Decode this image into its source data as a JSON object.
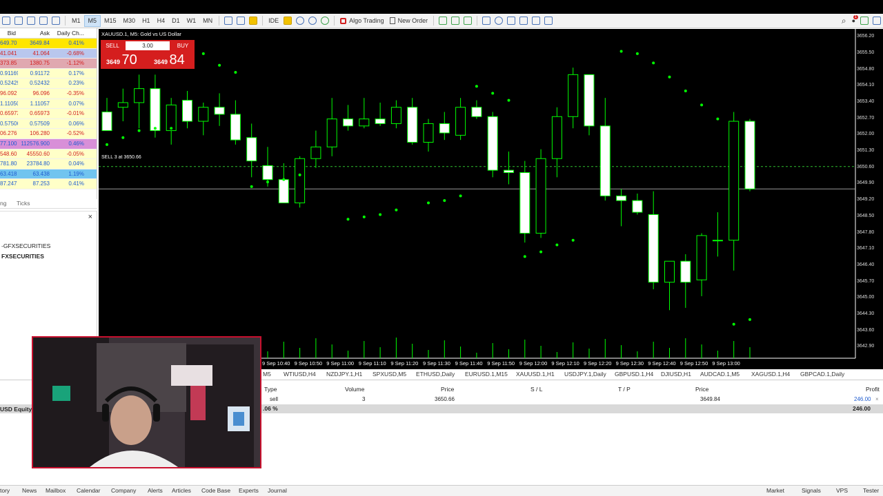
{
  "toolbar": {
    "timeframes": [
      "M1",
      "M5",
      "M15",
      "M30",
      "H1",
      "H4",
      "D1",
      "W1",
      "MN"
    ],
    "active_timeframe": "M5",
    "ide_label": "IDE",
    "algo_trading_label": "Algo Trading",
    "new_order_label": "New Order",
    "notification_count": "1"
  },
  "market_watch": {
    "headers": {
      "bid": "Bid",
      "ask": "Ask",
      "daily": "Daily Ch..."
    },
    "rows": [
      {
        "bid": "649.70",
        "ask": "3649.84",
        "change": "0.41%",
        "bg": "#ffe600"
      },
      {
        "bid": "41.041",
        "ask": "41.064",
        "change": "-0.68%",
        "bg": "#b9c7ee"
      },
      {
        "bid": "373.85",
        "ask": "1380.75",
        "change": "-1.12%",
        "bg": "#e0a8b0"
      },
      {
        "bid": "0.91169",
        "ask": "0.91172",
        "change": "0.17%",
        "bg": "#ffffc8"
      },
      {
        "bid": "0.52429",
        "ask": "0.52432",
        "change": "0.23%",
        "bg": "#ffffc8"
      },
      {
        "bid": "96.092",
        "ask": "96.096",
        "change": "-0.35%",
        "bg": "#ffffc8"
      },
      {
        "bid": "1.11050",
        "ask": "1.11057",
        "change": "0.07%",
        "bg": "#ffffc8"
      },
      {
        "bid": "0.65973",
        "ask": "0.65973",
        "change": "-0.01%",
        "bg": "#ffffc8"
      },
      {
        "bid": "0.57506",
        "ask": "0.57509",
        "change": "0.06%",
        "bg": "#ffffc8"
      },
      {
        "bid": "06.276",
        "ask": "106.280",
        "change": "-0.52%",
        "bg": "#ffffc8"
      },
      {
        "bid": "77.100",
        "ask": "112576.900",
        "change": "0.46%",
        "bg": "#d88fd8"
      },
      {
        "bid": "548.60",
        "ask": "45550.60",
        "change": "-0.05%",
        "bg": "#ffffc8"
      },
      {
        "bid": "781.80",
        "ask": "23784.80",
        "change": "0.04%",
        "bg": "#ffffc8"
      },
      {
        "bid": "63.418",
        "ask": "63.438",
        "change": "1.19%",
        "bg": "#71c4ef"
      },
      {
        "bid": "87.247",
        "ask": "87.253",
        "change": "0.41%",
        "bg": "#ffffc8"
      }
    ],
    "tabs": [
      "ng",
      "Ticks"
    ]
  },
  "navigator": {
    "close": "×",
    "servers": [
      "-GFXSECURITIES",
      "FXSECURITIES"
    ]
  },
  "chart": {
    "title": "XAUUSD.1, M5:  Gold vs US Dollar",
    "one_click": {
      "sell_label": "SELL",
      "buy_label": "BUY",
      "volume": "3.00",
      "sell_small": "3649",
      "sell_big": "70",
      "buy_small": "3649",
      "buy_big": "84"
    },
    "sell_line_label": "SELL 3 at 3650.66",
    "price_ticks": [
      "3656.20",
      "3655.50",
      "3654.80",
      "3654.10",
      "3653.40",
      "3652.70",
      "3652.00",
      "3651.30",
      "3650.60",
      "3649.90",
      "3649.20",
      "3648.50",
      "3647.80",
      "3647.10",
      "3646.40",
      "3645.70",
      "3645.00",
      "3644.30",
      "3643.60",
      "3642.90"
    ],
    "time_ticks": [
      "9 Sep 10:40",
      "9 Sep 10:50",
      "9 Sep 11:00",
      "9 Sep 11:10",
      "9 Sep 11:20",
      "9 Sep 11:30",
      "9 Sep 11:40",
      "9 Sep 11:50",
      "9 Sep 12:00",
      "9 Sep 12:10",
      "9 Sep 12:20",
      "9 Sep 12:30",
      "9 Sep 12:40",
      "9 Sep 12:50",
      "9 Sep 13:00"
    ],
    "colors": {
      "bull": "#00ff00",
      "bear_body": "#ffffff",
      "sar": "#00ff00",
      "bg": "#000000"
    }
  },
  "chart_data": {
    "type": "candlestick",
    "symbol": "XAUUSD.1",
    "timeframe": "M5",
    "ylim": [
      3642.5,
      3656.5
    ],
    "sell_order_price": 3650.66,
    "bid_line": 3649.7,
    "candles": [
      {
        "o": 3653.0,
        "h": 3653.6,
        "l": 3652.2,
        "c": 3652.2
      },
      {
        "o": 3653.2,
        "h": 3654.0,
        "l": 3652.6,
        "c": 3653.4
      },
      {
        "o": 3653.4,
        "h": 3654.6,
        "l": 3652.3,
        "c": 3654.0
      },
      {
        "o": 3654.0,
        "h": 3654.6,
        "l": 3651.9,
        "c": 3652.2
      },
      {
        "o": 3652.2,
        "h": 3653.6,
        "l": 3651.6,
        "c": 3653.3
      },
      {
        "o": 3653.5,
        "h": 3653.9,
        "l": 3652.3,
        "c": 3652.6
      },
      {
        "o": 3652.6,
        "h": 3653.4,
        "l": 3652.0,
        "c": 3653.2
      },
      {
        "o": 3653.2,
        "h": 3653.8,
        "l": 3652.4,
        "c": 3652.9
      },
      {
        "o": 3652.9,
        "h": 3653.5,
        "l": 3651.6,
        "c": 3651.8
      },
      {
        "o": 3651.9,
        "h": 3652.5,
        "l": 3650.2,
        "c": 3650.9
      },
      {
        "o": 3650.7,
        "h": 3651.5,
        "l": 3649.8,
        "c": 3650.1
      },
      {
        "o": 3650.1,
        "h": 3650.8,
        "l": 3649.1,
        "c": 3649.1
      },
      {
        "o": 3649.1,
        "h": 3651.1,
        "l": 3648.9,
        "c": 3651.0
      },
      {
        "o": 3651.0,
        "h": 3652.2,
        "l": 3650.6,
        "c": 3651.5
      },
      {
        "o": 3651.5,
        "h": 3653.6,
        "l": 3651.1,
        "c": 3652.7
      },
      {
        "o": 3652.7,
        "h": 3653.3,
        "l": 3652.2,
        "c": 3652.4
      },
      {
        "o": 3652.4,
        "h": 3653.6,
        "l": 3652.3,
        "c": 3652.7
      },
      {
        "o": 3652.7,
        "h": 3653.4,
        "l": 3652.4,
        "c": 3652.5
      },
      {
        "o": 3652.5,
        "h": 3653.5,
        "l": 3652.3,
        "c": 3653.2
      },
      {
        "o": 3653.2,
        "h": 3653.6,
        "l": 3651.6,
        "c": 3651.7
      },
      {
        "o": 3651.7,
        "h": 3652.7,
        "l": 3651.3,
        "c": 3652.5
      },
      {
        "o": 3652.5,
        "h": 3653.0,
        "l": 3651.8,
        "c": 3652.1
      },
      {
        "o": 3652.0,
        "h": 3653.6,
        "l": 3651.8,
        "c": 3653.2
      },
      {
        "o": 3653.2,
        "h": 3653.5,
        "l": 3652.7,
        "c": 3652.8
      },
      {
        "o": 3652.8,
        "h": 3653.0,
        "l": 3650.2,
        "c": 3650.5
      },
      {
        "o": 3650.5,
        "h": 3651.3,
        "l": 3649.9,
        "c": 3650.4
      },
      {
        "o": 3650.4,
        "h": 3650.9,
        "l": 3647.4,
        "c": 3647.8
      },
      {
        "o": 3647.8,
        "h": 3651.4,
        "l": 3647.6,
        "c": 3651.0
      },
      {
        "o": 3651.0,
        "h": 3653.2,
        "l": 3650.2,
        "c": 3652.8
      },
      {
        "o": 3652.8,
        "h": 3654.9,
        "l": 3652.3,
        "c": 3654.6
      },
      {
        "o": 3654.6,
        "h": 3654.6,
        "l": 3652.0,
        "c": 3652.4
      },
      {
        "o": 3652.4,
        "h": 3653.6,
        "l": 3649.2,
        "c": 3649.4
      },
      {
        "o": 3649.4,
        "h": 3649.7,
        "l": 3648.1,
        "c": 3649.2
      },
      {
        "o": 3649.2,
        "h": 3649.5,
        "l": 3648.6,
        "c": 3648.7
      },
      {
        "o": 3648.6,
        "h": 3649.6,
        "l": 3645.4,
        "c": 3645.7
      },
      {
        "o": 3645.7,
        "h": 3646.6,
        "l": 3644.5,
        "c": 3646.6
      },
      {
        "o": 3646.6,
        "h": 3646.9,
        "l": 3644.6,
        "c": 3645.7
      },
      {
        "o": 3645.8,
        "h": 3647.8,
        "l": 3645.1,
        "c": 3647.7
      },
      {
        "o": 3647.5,
        "h": 3648.7,
        "l": 3646.8,
        "c": 3647.5
      },
      {
        "o": 3647.5,
        "h": 3653.0,
        "l": 3646.2,
        "c": 3652.6
      },
      {
        "o": 3652.6,
        "h": 3652.7,
        "l": 3649.6,
        "c": 3649.7
      }
    ],
    "sar": [
      {
        "i": 0,
        "v": 3651.6
      },
      {
        "i": 1,
        "v": 3651.9
      },
      {
        "i": 2,
        "v": 3652.2
      },
      {
        "i": 3,
        "v": 3652.3
      },
      {
        "i": 4,
        "v": 3652.3
      },
      {
        "i": 5,
        "v": 3655.8
      },
      {
        "i": 6,
        "v": 3655.5
      },
      {
        "i": 7,
        "v": 3655.0
      },
      {
        "i": 8,
        "v": 3654.7
      },
      {
        "i": 9,
        "v": 3649.8
      },
      {
        "i": 10,
        "v": 3650.0
      },
      {
        "i": 11,
        "v": 3650.1
      },
      {
        "i": 12,
        "v": 3650.3
      },
      {
        "i": 15,
        "v": 3648.4
      },
      {
        "i": 16,
        "v": 3648.5
      },
      {
        "i": 17,
        "v": 3648.6
      },
      {
        "i": 18,
        "v": 3648.8
      },
      {
        "i": 20,
        "v": 3649.1
      },
      {
        "i": 21,
        "v": 3649.2
      },
      {
        "i": 22,
        "v": 3649.4
      },
      {
        "i": 23,
        "v": 3654.1
      },
      {
        "i": 24,
        "v": 3653.8
      },
      {
        "i": 25,
        "v": 3653.5
      },
      {
        "i": 26,
        "v": 3646.8
      },
      {
        "i": 27,
        "v": 3647.0
      },
      {
        "i": 28,
        "v": 3647.3
      },
      {
        "i": 29,
        "v": 3647.5
      },
      {
        "i": 32,
        "v": 3655.6
      },
      {
        "i": 33,
        "v": 3655.5
      },
      {
        "i": 34,
        "v": 3655.1
      },
      {
        "i": 35,
        "v": 3654.5
      },
      {
        "i": 36,
        "v": 3653.9
      },
      {
        "i": 37,
        "v": 3653.3
      },
      {
        "i": 38,
        "v": 3652.7
      },
      {
        "i": 39,
        "v": 3643.9
      },
      {
        "i": 40,
        "v": 3644.1
      }
    ]
  },
  "symbol_tabs": [
    "M5",
    "WTIUSD,H4",
    "NZDJPY.1,H1",
    "SPXUSD,M5",
    "ETHUSD,Daily",
    "EURUSD.1,M15",
    "XAUUSD.1,H1",
    "USDJPY.1,Daily",
    "GBPUSD.1,H4",
    "DJIUSD,H1",
    "AUDCAD.1,M5",
    "XAGUSD.1,H4",
    "GBPCAD.1,Daily"
  ],
  "trade": {
    "headers": {
      "type": "Type",
      "volume": "Volume",
      "price": "Price",
      "sl": "S / L",
      "tp": "T / P",
      "price2": "Price",
      "profit": "Profit"
    },
    "row": {
      "type": "sell",
      "volume": "3",
      "price": "3650.66",
      "price2": "3649.84",
      "profit": "246.00"
    },
    "equity_label": "USD  Equity",
    "equity_pct": ".06 %",
    "equity_profit": "246.00"
  },
  "statusbar": {
    "left": [
      "tory",
      "News",
      "Mailbox",
      "Calendar",
      "Company",
      "Alerts",
      "Articles",
      "Code Base",
      "Experts",
      "Journal"
    ],
    "right": [
      "Market",
      "Signals",
      "VPS",
      "Tester"
    ]
  }
}
